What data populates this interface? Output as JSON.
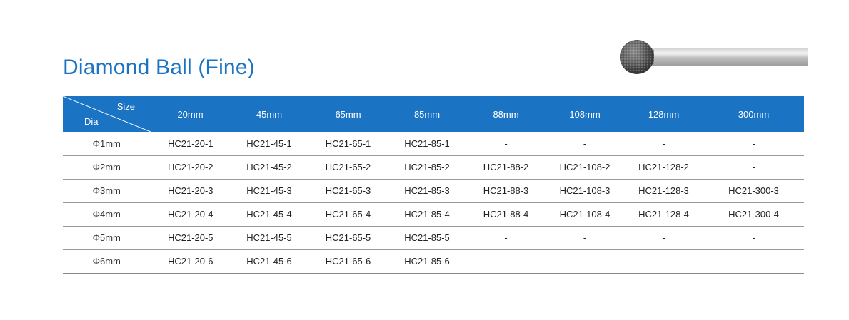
{
  "title": "Diamond Ball (Fine)",
  "table": {
    "corner_top": "Size",
    "corner_bottom": "Dia",
    "columns": [
      "20mm",
      "45mm",
      "65mm",
      "85mm",
      "88mm",
      "108mm",
      "128mm",
      "300mm"
    ],
    "rows": [
      {
        "dia": "Φ1mm",
        "cells": [
          "HC21-20-1",
          "HC21-45-1",
          "HC21-65-1",
          "HC21-85-1",
          "-",
          "-",
          "-",
          "-"
        ]
      },
      {
        "dia": "Φ2mm",
        "cells": [
          "HC21-20-2",
          "HC21-45-2",
          "HC21-65-2",
          "HC21-85-2",
          "HC21-88-2",
          "HC21-108-2",
          "HC21-128-2",
          "-"
        ]
      },
      {
        "dia": "Φ3mm",
        "cells": [
          "HC21-20-3",
          "HC21-45-3",
          "HC21-65-3",
          "HC21-85-3",
          "HC21-88-3",
          "HC21-108-3",
          "HC21-128-3",
          "HC21-300-3"
        ]
      },
      {
        "dia": "Φ4mm",
        "cells": [
          "HC21-20-4",
          "HC21-45-4",
          "HC21-65-4",
          "HC21-85-4",
          "HC21-88-4",
          "HC21-108-4",
          "HC21-128-4",
          "HC21-300-4"
        ]
      },
      {
        "dia": "Φ5mm",
        "cells": [
          "HC21-20-5",
          "HC21-45-5",
          "HC21-65-5",
          "HC21-85-5",
          "-",
          "-",
          "-",
          "-"
        ]
      },
      {
        "dia": "Φ6mm",
        "cells": [
          "HC21-20-6",
          "HC21-45-6",
          "HC21-65-6",
          "HC21-85-6",
          "-",
          "-",
          "-",
          "-"
        ]
      }
    ]
  },
  "colors": {
    "header_bg": "#1a73c3",
    "title": "#1a73c3"
  }
}
